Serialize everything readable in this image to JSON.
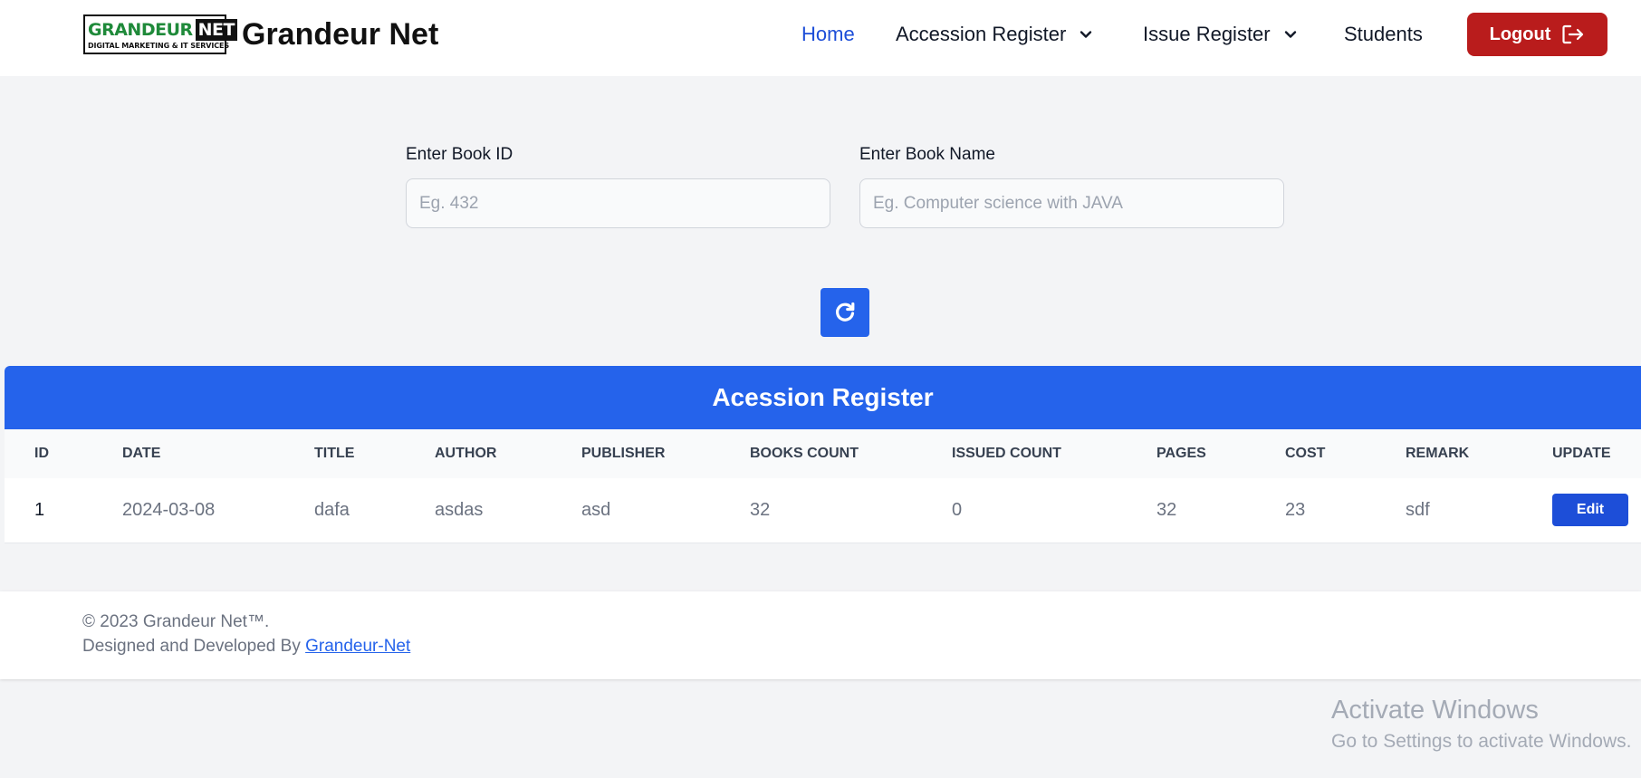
{
  "navbar": {
    "logo_word1": "GRANDEUR",
    "logo_word2": "NET",
    "logo_tagline": "DIGITAL MARKETING & IT SERVICES",
    "brand": "Grandeur Net",
    "items": [
      {
        "label": "Home",
        "active": true
      },
      {
        "label": "Accession Register",
        "dropdown": true
      },
      {
        "label": "Issue Register",
        "dropdown": true
      },
      {
        "label": "Students"
      }
    ],
    "logout_label": "Logout",
    "active_color": "#1d4ed8",
    "logout_color": "#b91c1c"
  },
  "search": {
    "book_id_label": "Enter Book ID",
    "book_id_placeholder": "Eg. 432",
    "book_id_value": "",
    "book_name_label": "Enter Book Name",
    "book_name_placeholder": "Eg. Computer science with JAVA",
    "book_name_value": "",
    "refresh_icon": "refresh-icon"
  },
  "table": {
    "title": "Acession Register",
    "header_color": "#2563eb",
    "columns": [
      "ID",
      "DATE",
      "TITLE",
      "AUTHOR",
      "PUBLISHER",
      "BOOKS COUNT",
      "ISSUED COUNT",
      "PAGES",
      "COST",
      "REMARK",
      "UPDATE"
    ],
    "rows": [
      {
        "id": "1",
        "date": "2024-03-08",
        "title": "dafa",
        "author": "asdas",
        "publisher": "asd",
        "books_count": "32",
        "issued_count": "0",
        "pages": "32",
        "cost": "23",
        "remark": "sdf",
        "edit_label": "Edit"
      }
    ]
  },
  "footer": {
    "copyright": "© 2023 Grandeur Net™.",
    "designed_by": "Designed and Developed By ",
    "link_text": "Grandeur-Net"
  },
  "watermark": {
    "title": "Activate Windows",
    "subtitle": "Go to Settings to activate Windows."
  }
}
